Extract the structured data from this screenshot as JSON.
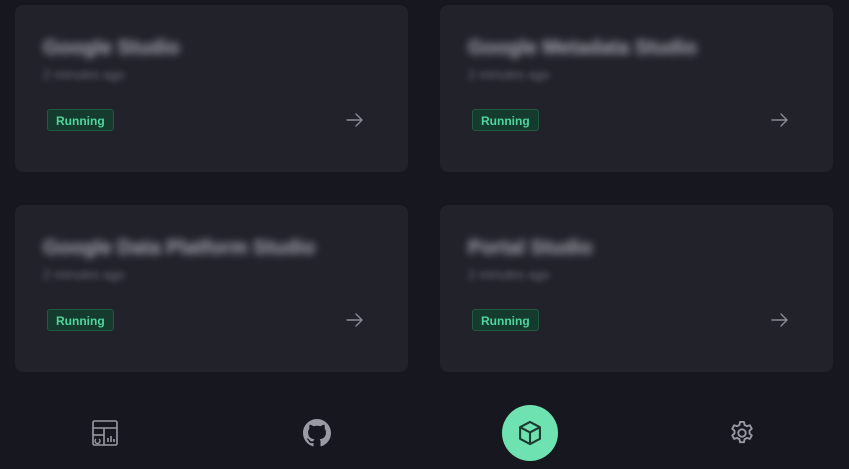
{
  "cards": [
    {
      "title": "Google Studio",
      "subtitle": "2 minutes ago",
      "status": "Running"
    },
    {
      "title": "Google Metadata Studio",
      "subtitle": "2 minutes ago",
      "status": "Running"
    },
    {
      "title": "Google Data Platform Studio",
      "subtitle": "2 minutes ago",
      "status": "Running"
    },
    {
      "title": "Portal Studio",
      "subtitle": "2 minutes ago",
      "status": "Running"
    }
  ],
  "nav": {
    "items": [
      {
        "icon": "dashboard-icon"
      },
      {
        "icon": "github-icon"
      },
      {
        "icon": "cube-icon",
        "active": true
      },
      {
        "icon": "gear-icon"
      }
    ]
  },
  "colors": {
    "background": "#17171f",
    "card": "#22222b",
    "accent": "#6ee2b0",
    "badge_text": "#4fd69c",
    "badge_bg": "#153b2e"
  }
}
